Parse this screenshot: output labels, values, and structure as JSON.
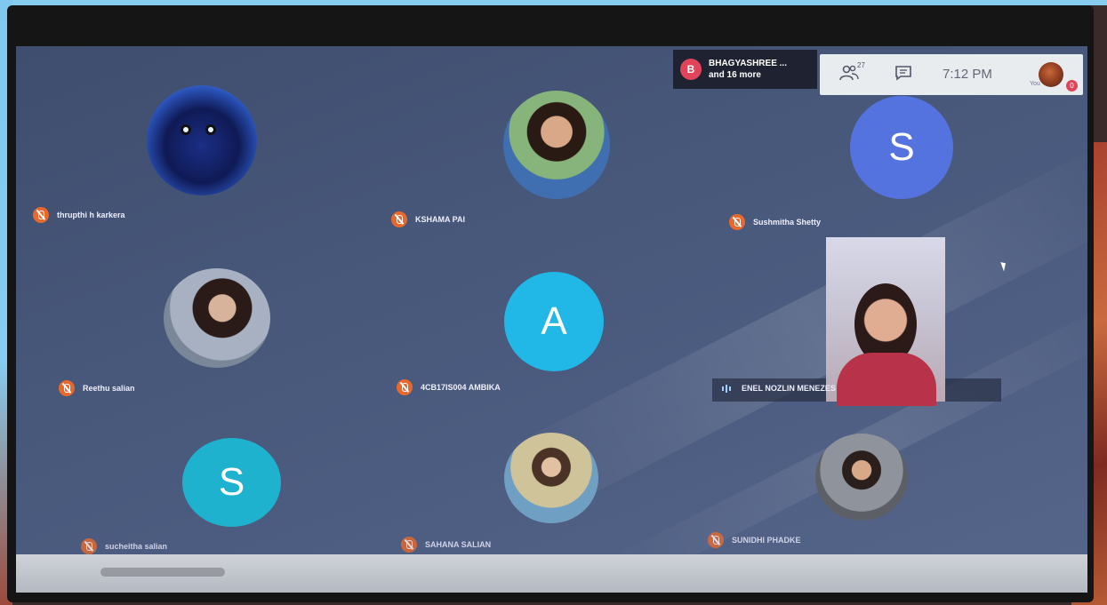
{
  "presenter": {
    "avatar_letter": "B",
    "name": "BHAGYASHREE ...",
    "more": "and 16 more"
  },
  "toolbar": {
    "participant_count": "27",
    "time": "7:12 PM",
    "self_label": "You",
    "badge": "0"
  },
  "participants": [
    {
      "name": "thrupthi h karkera",
      "muted": true,
      "avatar": "photo"
    },
    {
      "name": "KSHAMA PAI",
      "muted": true,
      "avatar": "photo"
    },
    {
      "name": "Sushmitha Shetty",
      "muted": true,
      "avatar": "letter",
      "letter": "S",
      "color": "#5573de"
    },
    {
      "name": "Reethu salian",
      "muted": true,
      "avatar": "photo"
    },
    {
      "name": "4CB17IS004 AMBIKA",
      "muted": true,
      "avatar": "letter",
      "letter": "A",
      "color": "#21b7e6"
    },
    {
      "name": "ENEL NOZLIN MENEZES",
      "muted": false,
      "avatar": "video"
    },
    {
      "name": "sucheitha salian",
      "muted": true,
      "avatar": "letter",
      "letter": "S",
      "color": "#1fb2cf"
    },
    {
      "name": "SAHANA SALIAN",
      "muted": true,
      "avatar": "photo"
    },
    {
      "name": "SUNIDHI PHADKE",
      "muted": true,
      "avatar": "photo"
    }
  ],
  "colors": {
    "background": "#475779",
    "mute_badge": "#e8692e",
    "presenter_badge": "#e0445a"
  }
}
